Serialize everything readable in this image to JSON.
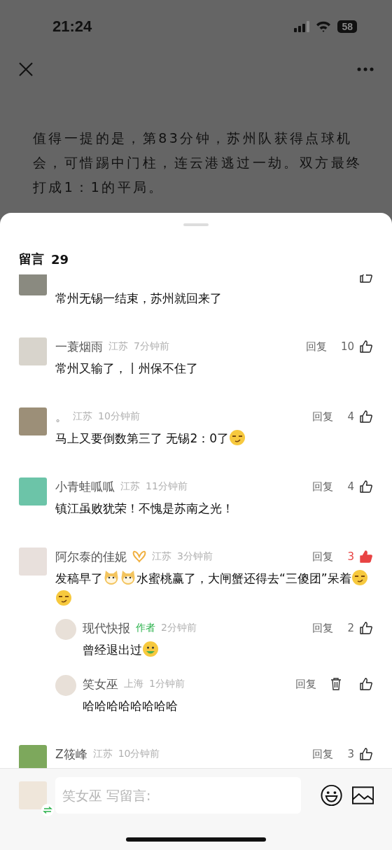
{
  "status_bar": {
    "time": "21:24",
    "battery": "58"
  },
  "article": {
    "paragraphs": [
      "值得一提的是，第83分钟，苏州队获得点球机会，可惜踢中门柱，连云港逃过一劫。双方最终打成1：1的平局。"
    ]
  },
  "comments_header": {
    "title": "留言",
    "count": "29"
  },
  "comments": [
    {
      "badge": false,
      "liked": false,
      "content": [
        {
          "kind": "text",
          "text": "常州无锡一结束，苏州就回来了"
        }
      ]
    },
    {
      "name": "一蓑烟雨",
      "badge": false,
      "location": "江苏",
      "time": "7分钟前",
      "reply": "回复",
      "likes": "10",
      "liked": false,
      "content": [
        {
          "kind": "text",
          "text": "常州又输了，丨州保不住了"
        }
      ]
    },
    {
      "name": "。",
      "badge": false,
      "location": "江苏",
      "time": "10分钟前",
      "reply": "回复",
      "likes": "4",
      "liked": false,
      "content": [
        {
          "kind": "text",
          "text": "马上又要倒数第三了 无锡2：0了"
        },
        {
          "kind": "smirk"
        }
      ]
    },
    {
      "name": "小青蛙呱呱",
      "badge": false,
      "location": "江苏",
      "time": "11分钟前",
      "reply": "回复",
      "likes": "4",
      "liked": false,
      "content": [
        {
          "kind": "text",
          "text": "镇江虽败犹荣！不愧是苏南之光！"
        }
      ]
    },
    {
      "name": "阿尔泰的佳妮",
      "badge": true,
      "location": "江苏",
      "time": "3分钟前",
      "reply": "回复",
      "likes": "3",
      "liked": true,
      "content": [
        {
          "kind": "text",
          "text": "发稿早了"
        },
        {
          "kind": "doge"
        },
        {
          "kind": "doge"
        },
        {
          "kind": "text",
          "text": "水蜜桃赢了，大闸蟹还得去“三傻团”呆着"
        },
        {
          "kind": "smirk"
        },
        {
          "kind": "smirk"
        }
      ],
      "replies": [
        {
          "name": "现代快报",
          "author_tag": "作者",
          "time": "2分钟前",
          "reply": "回复",
          "deletable": false,
          "likes": "2",
          "liked": false,
          "content": [
            {
              "kind": "text",
              "text": "曾经退出过"
            },
            {
              "kind": "grin"
            }
          ]
        },
        {
          "name": "笑女巫",
          "location": "上海",
          "time": "1分钟前",
          "reply": "回复",
          "deletable": true,
          "liked": false,
          "content": [
            {
              "kind": "text",
              "text": "哈哈哈哈哈哈哈哈"
            }
          ]
        }
      ]
    },
    {
      "name": "Z筱峰",
      "badge": false,
      "location": "江苏",
      "time": "10分钟前",
      "reply": "回复",
      "likes": "3",
      "liked": false
    }
  ],
  "composer": {
    "placeholder": "笑女巫 写留言:"
  }
}
